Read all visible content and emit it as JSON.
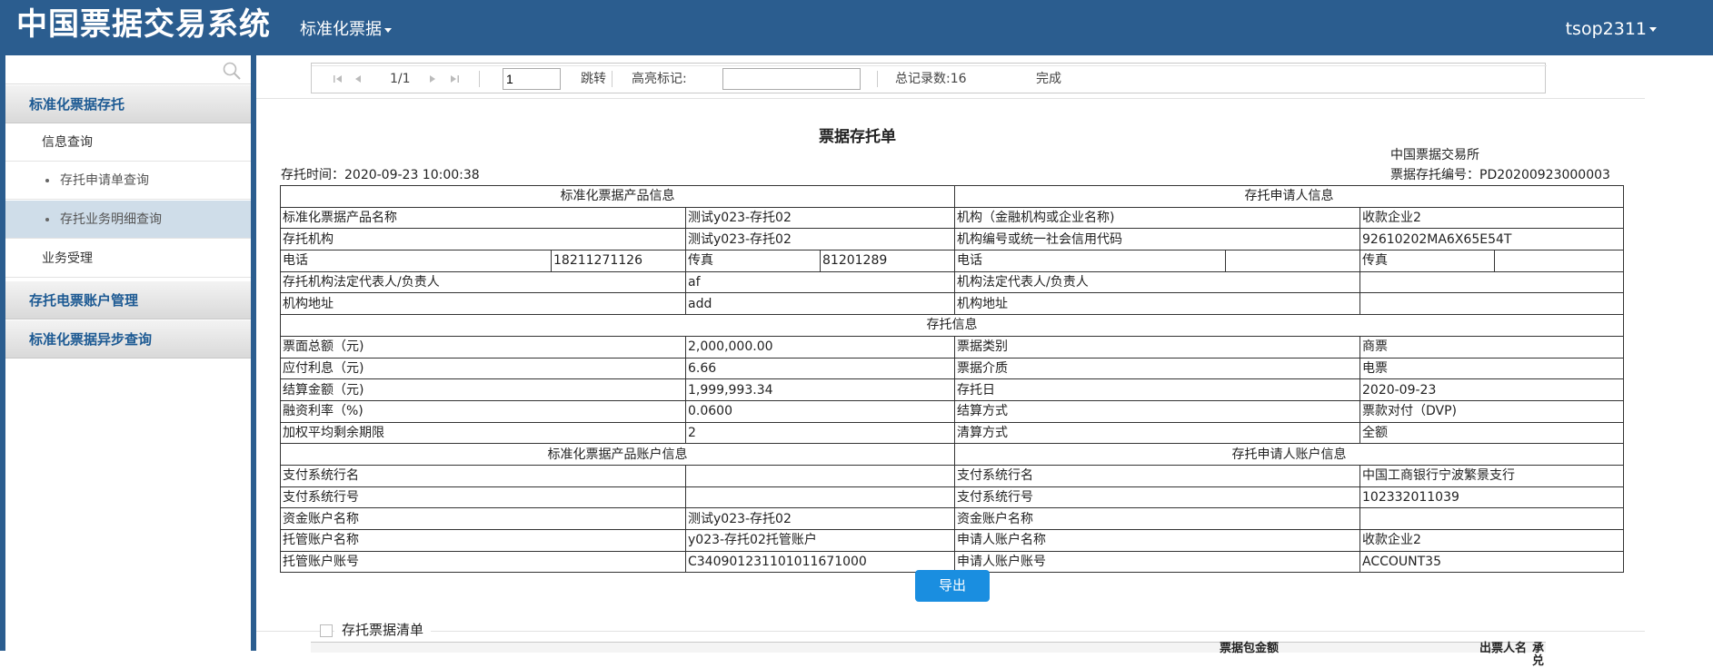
{
  "header": {
    "app_title": "中国票据交易系统",
    "nav_menu": "标准化票据",
    "user": "tsop2311"
  },
  "sidebar": {
    "search_placeholder": "",
    "groups": [
      {
        "label": "标准化票据存托"
      },
      {
        "label": "存托电票账户管理"
      },
      {
        "label": "标准化票据异步查询"
      }
    ],
    "subs": [
      {
        "label": "信息查询"
      },
      {
        "label": "业务受理"
      }
    ],
    "leaves": [
      {
        "label": "存托申请单查询"
      },
      {
        "label": "存托业务明细查询"
      }
    ]
  },
  "pager": {
    "page": "1/1",
    "page_input": "1",
    "jump": "跳转",
    "highlight_label": "高亮标记:",
    "highlight_value": "",
    "total": "总记录数:16",
    "status": "完成"
  },
  "doc": {
    "title": "票据存托单",
    "issuer": "中国票据交易所",
    "deposit_time": "存托时间：2020-09-23 10:00:38",
    "deposit_no": "票据存托编号：PD20200923000003",
    "sec_product_info": "标准化票据产品信息",
    "sec_applicant_info": "存托申请人信息",
    "sec_deposit_info": "存托信息",
    "sec_product_account": "标准化票据产品账户信息",
    "sec_applicant_account": "存托申请人账户信息",
    "rows": {
      "product_name_label": "标准化票据产品名称",
      "product_name": "测试y023-存托02",
      "org_label": "机构（金融机构或企业名称)",
      "org": "收款企业2",
      "custodian_label": "存托机构",
      "custodian": "测试y023-存托02",
      "org_code_label": "机构编号或统一社会信用代码",
      "org_code": "92610202MA6X65E54T",
      "phone_label": "电话",
      "phone": "18211271126",
      "fax_label": "传真",
      "fax": "81201289",
      "phone2_label": "电话",
      "phone2": "",
      "fax2_label": "传真",
      "fax2": "",
      "legal_rep_label": "存托机构法定代表人/负责人",
      "legal_rep": "af",
      "legal_rep2_label": "机构法定代表人/负责人",
      "legal_rep2": "",
      "address_label": "机构地址",
      "address": "add",
      "address2_label": "机构地址",
      "address2": "",
      "face_total_label": "票面总额（元)",
      "face_total": "2,000,000.00",
      "bill_type_label": "票据类别",
      "bill_type": "商票",
      "interest_label": "应付利息（元)",
      "interest": "6.66",
      "medium_label": "票据介质",
      "medium": "电票",
      "settle_amount_label": "结算金额（元)",
      "settle_amount": "1,999,993.34",
      "deposit_day_label": "存托日",
      "deposit_day": "2020-09-23",
      "rate_label": "融资利率（%)",
      "rate": "0.0600",
      "settle_method_label": "结算方式",
      "settle_method": "票款对付（DVP)",
      "term_label": "加权平均剩余期限",
      "term": "2",
      "clear_method_label": "清算方式",
      "clear_method": "全额",
      "pay_bank_name_label": "支付系统行名",
      "pay_bank_name": "",
      "pay_bank_name2_label": "支付系统行名",
      "pay_bank_name2": "中国工商银行宁波繁景支行",
      "pay_bank_no_label": "支付系统行号",
      "pay_bank_no": "",
      "pay_bank_no2_label": "支付系统行号",
      "pay_bank_no2": "102332011039",
      "fund_acct_label": "资金账户名称",
      "fund_acct": "测试y023-存托02",
      "fund_acct2_label": "资金账户名称",
      "fund_acct2": "",
      "trust_acct_name_label": "托管账户名称",
      "trust_acct_name": "y023-存托02托管账户",
      "app_acct_name_label": "申请人账户名称",
      "app_acct_name": "收款企业2",
      "trust_acct_no_label": "托管账户账号",
      "trust_acct_no": "C340901231101011671000",
      "app_acct_no_label": "申请人账户账号",
      "app_acct_no": "ACCOUNT35"
    }
  },
  "export_label": "导出",
  "list": {
    "title": "存托票据清单",
    "partial_headers": [
      "票据包金额",
      "出票人名",
      "承兑"
    ]
  },
  "colors": {
    "header_bg": "#2b5d8f",
    "menu_text": "#1d5a93",
    "export_bg": "#1a8ee0",
    "active_leaf": "#cfdde9"
  }
}
